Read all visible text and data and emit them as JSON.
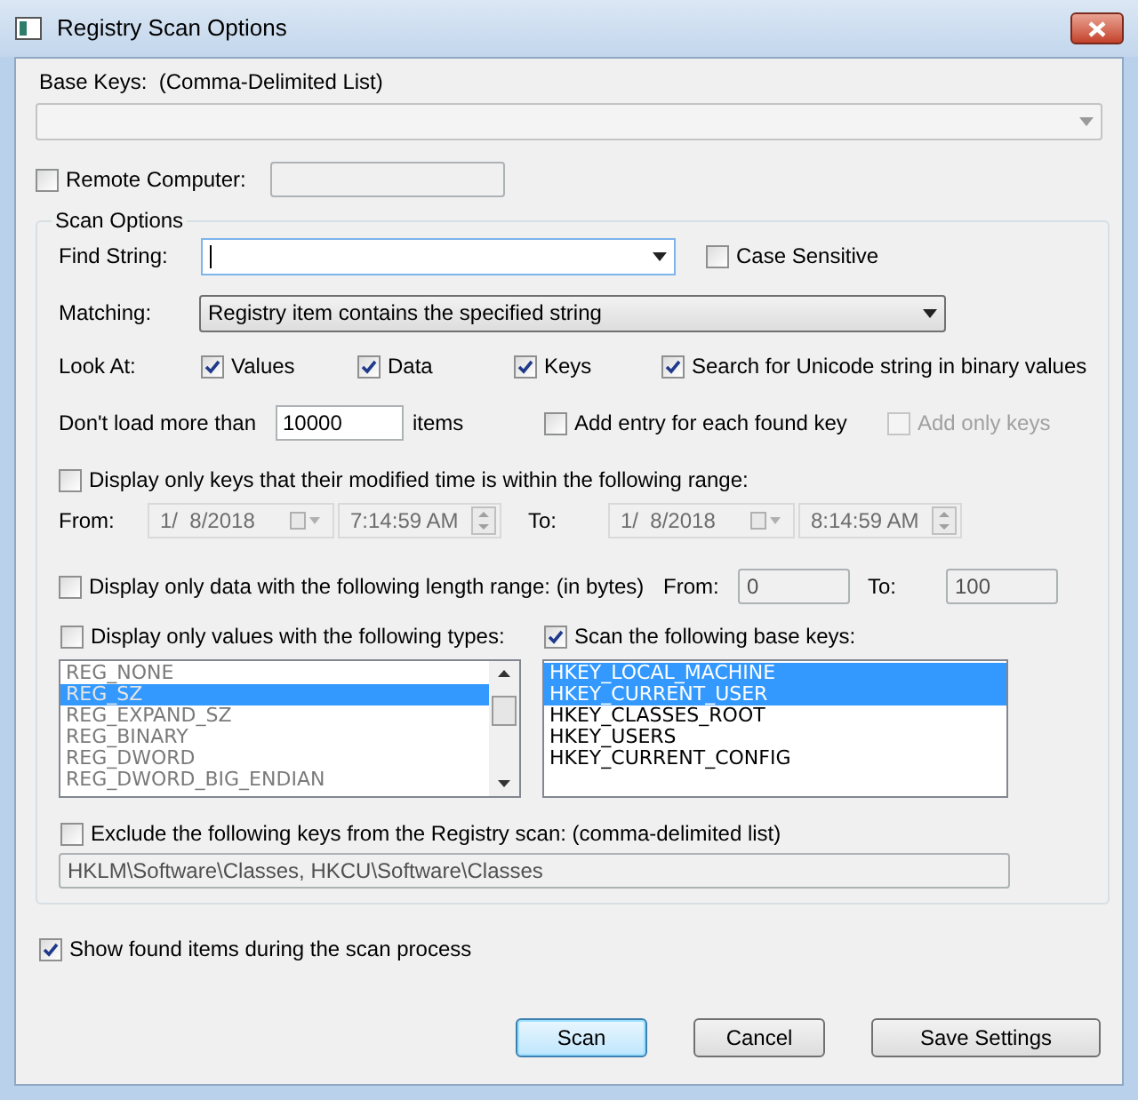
{
  "window": {
    "title": "Registry Scan Options"
  },
  "base_keys": {
    "label": "Base Keys:  (Comma-Delimited List)"
  },
  "remote_computer": {
    "label": "Remote Computer:",
    "checked": false
  },
  "scan_options": {
    "title": "Scan Options",
    "find_string": {
      "label": "Find String:"
    },
    "case_sensitive": {
      "label": "Case Sensitive",
      "checked": false
    },
    "matching": {
      "label": "Matching:",
      "value": "Registry item contains the specified string"
    },
    "look_at": {
      "label": "Look At:",
      "options": [
        {
          "label": "Values",
          "checked": true
        },
        {
          "label": "Data",
          "checked": true
        },
        {
          "label": "Keys",
          "checked": true
        }
      ]
    },
    "unicode": {
      "label": "Search for Unicode string in binary values",
      "checked": true
    },
    "max_items": {
      "label": "Don't load more than",
      "value": "10000",
      "unit": "items"
    },
    "add_entry": {
      "label": "Add entry for each found key",
      "checked": false
    },
    "add_only_keys": {
      "label": "Add only keys",
      "checked": false,
      "disabled": true
    },
    "time_filter": {
      "label": "Display only keys that their modified time is within the following range:",
      "checked": false,
      "from_label": "From:",
      "from_date": "1/  8/2018",
      "from_time": "7:14:59 AM",
      "to_label": "To:",
      "to_date": "1/  8/2018",
      "to_time": "8:14:59 AM"
    },
    "length_filter": {
      "label": "Display only data with the following length range: (in bytes)",
      "checked": false,
      "from_label": "From:",
      "from_value": "0",
      "to_label": "To:",
      "to_value": "100"
    },
    "type_filter": {
      "label": "Display only values with the following types:",
      "checked": false,
      "disabled": true,
      "items": [
        {
          "label": "REG_NONE",
          "selected": false
        },
        {
          "label": "REG_SZ",
          "selected": true
        },
        {
          "label": "REG_EXPAND_SZ",
          "selected": false
        },
        {
          "label": "REG_BINARY",
          "selected": false
        },
        {
          "label": "REG_DWORD",
          "selected": false
        },
        {
          "label": "REG_DWORD_BIG_ENDIAN",
          "selected": false
        }
      ]
    },
    "base_key_filter": {
      "label": "Scan the following base keys:",
      "checked": true,
      "disabled": false,
      "items": [
        {
          "label": "HKEY_LOCAL_MACHINE",
          "selected": true
        },
        {
          "label": "HKEY_CURRENT_USER",
          "selected": true
        },
        {
          "label": "HKEY_CLASSES_ROOT",
          "selected": false
        },
        {
          "label": "HKEY_USERS",
          "selected": false
        },
        {
          "label": "HKEY_CURRENT_CONFIG",
          "selected": false
        }
      ]
    },
    "exclude": {
      "label": "Exclude the following keys from the Registry scan: (comma-delimited list)",
      "checked": false,
      "value": "HKLM\\Software\\Classes, HKCU\\Software\\Classes"
    }
  },
  "show_found": {
    "label": "Show found items during the scan process",
    "checked": true
  },
  "buttons": [
    {
      "label": "Scan",
      "focused": true
    },
    {
      "label": "Cancel",
      "focused": false
    },
    {
      "label": "Save Settings",
      "focused": false
    }
  ]
}
